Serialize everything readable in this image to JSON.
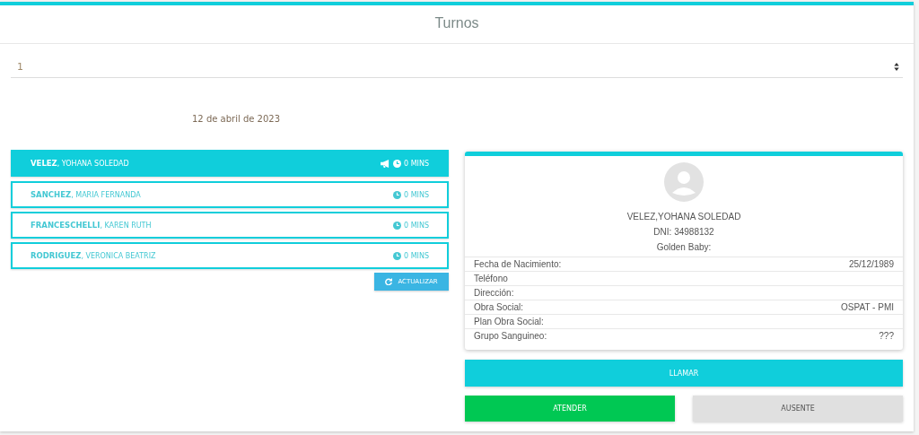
{
  "page": {
    "title": "Turnos"
  },
  "select": {
    "value": "1"
  },
  "date": "12 de abril de 2023",
  "queue": [
    {
      "surname": "VELEZ",
      "given": ", YOHANA SOLEDAD",
      "called": true,
      "wait": "0 MINS",
      "selected": true
    },
    {
      "surname": "SANCHEZ",
      "given": ", MARIA FERNANDA",
      "called": false,
      "wait": "0 MINS",
      "selected": false
    },
    {
      "surname": "FRANCESCHELLI",
      "given": ", KAREN RUTH",
      "called": false,
      "wait": "0 MINS",
      "selected": false
    },
    {
      "surname": "RODRIGUEZ",
      "given": ", VERONICA BEATRIZ",
      "called": false,
      "wait": "0 MINS",
      "selected": false
    }
  ],
  "refresh_button": "ACTUALIZAR",
  "patient": {
    "name": "VELEZ,YOHANA SOLEDAD",
    "dni": "DNI: 34988132",
    "extra": "Golden Baby:",
    "fields": [
      {
        "label": "Fecha de Nacimiento:",
        "value": "25/12/1989"
      },
      {
        "label": "Teléfono"
      },
      {
        "label": "Dirección:"
      },
      {
        "label": "Obra Social:",
        "value": "OSPAT - PMI"
      },
      {
        "label": "Plan Obra Social:"
      },
      {
        "label": "Grupo Sanguineo:",
        "value": "???"
      }
    ]
  },
  "actions": {
    "call": "LLAMAR",
    "attend": "ATENDER",
    "absent": "AUSENTE"
  }
}
